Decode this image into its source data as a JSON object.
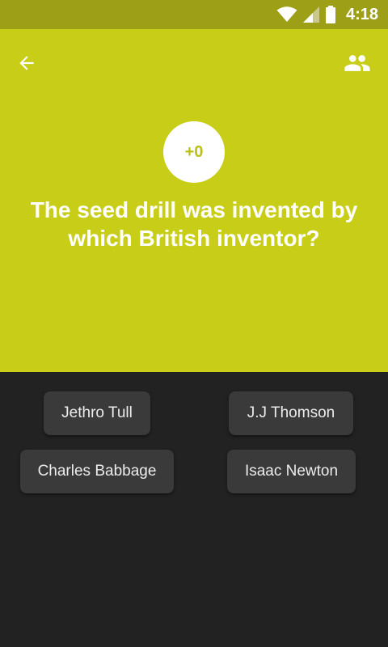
{
  "status_bar": {
    "time": "4:18",
    "icons": [
      "wifi-icon",
      "cell-signal-icon",
      "battery-icon"
    ]
  },
  "header": {
    "back_icon": "arrow-back-icon",
    "group_icon": "people-icon",
    "score": "+0",
    "question": "The seed drill was invented by which British inventor?"
  },
  "answers": [
    {
      "label": "Jethro Tull"
    },
    {
      "label": "J.J Thomson"
    },
    {
      "label": "Charles Babbage"
    },
    {
      "label": "Isaac Newton"
    }
  ],
  "colors": {
    "status_bar": "#9d9f16",
    "header": "#c8cd17",
    "background": "#222222",
    "answer_button": "#3a3a3a",
    "score_text": "#b9c117"
  }
}
